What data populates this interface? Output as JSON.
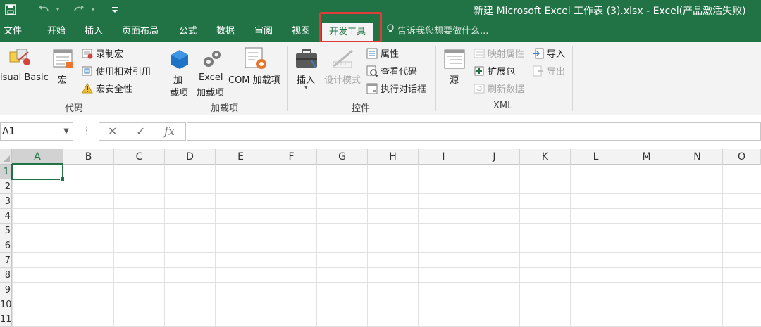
{
  "window": {
    "title": "新建 Microsoft Excel 工作表 (3).xlsx - Excel(产品激活失败)",
    "accent_color": "#217346",
    "highlight_color": "#e03c3c"
  },
  "quick_access": {
    "save_icon": "save-icon",
    "undo_icon": "undo-icon",
    "redo_icon": "redo-icon",
    "customize_icon": "customize-icon"
  },
  "tabs": [
    {
      "label": "文件"
    },
    {
      "label": "开始"
    },
    {
      "label": "插入"
    },
    {
      "label": "页面布局"
    },
    {
      "label": "公式"
    },
    {
      "label": "数据"
    },
    {
      "label": "审阅"
    },
    {
      "label": "视图"
    },
    {
      "label": "开发工具",
      "active": true
    }
  ],
  "tell_me": "告诉我您想要做什么...",
  "ribbon": {
    "code": {
      "label": "代码",
      "visual_basic": "isual Basic",
      "macros": "宏",
      "record_macro": "录制宏",
      "relative_ref": "使用相对引用",
      "macro_security": "宏安全性"
    },
    "addins": {
      "label": "加载项",
      "addins_line1": "加",
      "addins_line2": "载项",
      "excel_addins_line1": "Excel",
      "excel_addins_line2": "加载项",
      "com_addins": "COM 加载项"
    },
    "controls": {
      "label": "控件",
      "insert": "插入",
      "design_mode": "设计模式",
      "properties": "属性",
      "view_code": "查看代码",
      "run_dialog": "执行对话框"
    },
    "xml": {
      "label": "XML",
      "source": "源",
      "map_properties": "映射属性",
      "expansion_packs": "扩展包",
      "refresh_data": "刷新数据",
      "import": "导入",
      "export": "导出"
    }
  },
  "formula_bar": {
    "name_box": "A1",
    "cancel": "✕",
    "enter": "✓",
    "fx": "fx",
    "value": ""
  },
  "sheet": {
    "columns": [
      "A",
      "B",
      "C",
      "D",
      "E",
      "F",
      "G",
      "H",
      "I",
      "J",
      "K",
      "L",
      "M",
      "N",
      "O"
    ],
    "rows": [
      "1",
      "2",
      "3",
      "4",
      "5",
      "6",
      "7",
      "8",
      "9",
      "10",
      "11"
    ],
    "active_cell": "A1"
  }
}
